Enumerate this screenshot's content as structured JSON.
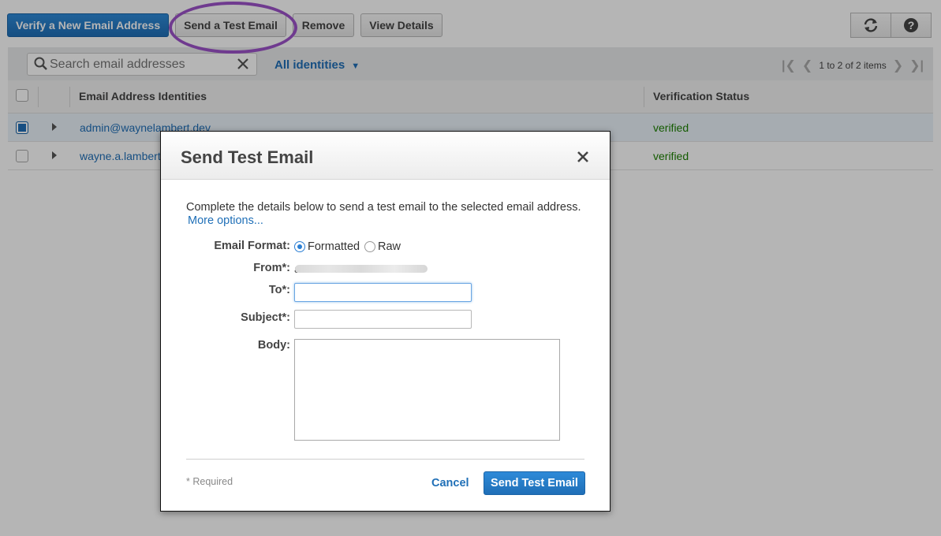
{
  "toolbar": {
    "verify_label": "Verify a New Email Address",
    "send_test_label": "Send a Test Email",
    "remove_label": "Remove",
    "details_label": "View Details",
    "refresh_icon": "refresh-icon",
    "help_icon": "help-icon"
  },
  "filter": {
    "search_placeholder": "Search email addresses",
    "dropdown_label": "All identities",
    "pager_text": "1 to 2 of 2 items"
  },
  "table": {
    "columns": [
      "Email Address Identities",
      "Verification Status"
    ],
    "rows": [
      {
        "email": "admin@waynelambert.dev",
        "status": "verified",
        "selected": true
      },
      {
        "email": "wayne.a.lambert",
        "status": "verified",
        "selected": false
      }
    ]
  },
  "modal": {
    "title": "Send Test Email",
    "intro": "Complete the details below to send a test email to the selected email address.",
    "more_options": "More options...",
    "format_label": "Email Format:",
    "format_options": [
      "Formatted",
      "Raw"
    ],
    "format_selected": "Formatted",
    "from_label": "From*:",
    "from_value_visible": "a",
    "to_label": "To*:",
    "to_value": "",
    "subject_label": "Subject*:",
    "subject_value": "",
    "body_label": "Body:",
    "body_value": "",
    "required_note": "* Required",
    "cancel_label": "Cancel",
    "submit_label": "Send Test Email"
  },
  "colors": {
    "accent": "#1f6fb7",
    "verified": "#1d8102",
    "annotation": "#6f3a8f"
  }
}
